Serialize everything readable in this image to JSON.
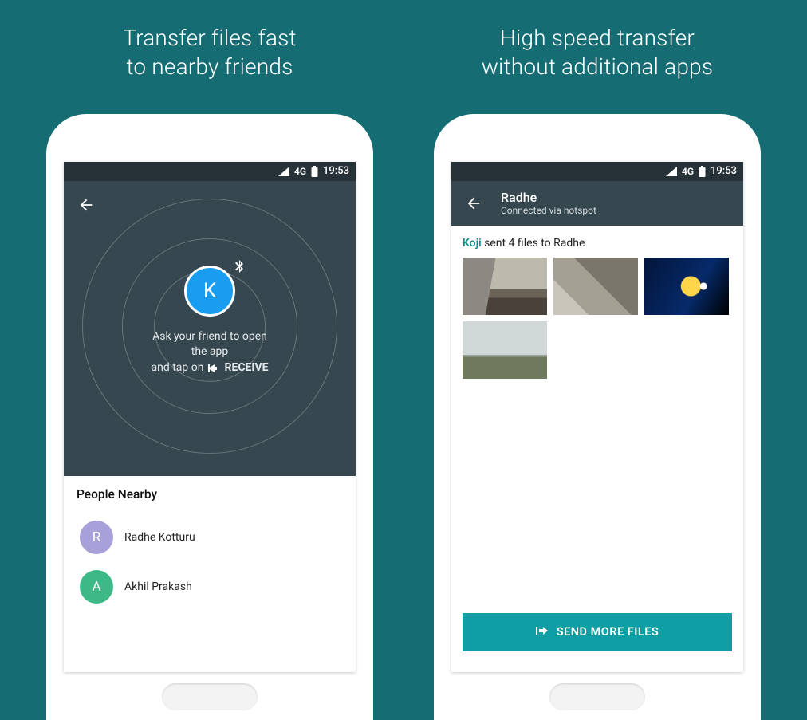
{
  "left": {
    "headline_l1": "Transfer files fast",
    "headline_l2": "to nearby friends",
    "status": {
      "network": "4G",
      "time": "19:53"
    },
    "avatar_letter": "K",
    "hint_l1": "Ask your friend to open the app",
    "hint_l2_prefix": "and tap on",
    "hint_l2_action": "RECEIVE",
    "list_title": "People Nearby",
    "people": [
      {
        "initial": "R",
        "name": "Radhe Kotturu",
        "color": "#a8a0d8"
      },
      {
        "initial": "A",
        "name": "Akhil Prakash",
        "color": "#3db887"
      }
    ]
  },
  "right": {
    "headline_l1": "High speed transfer",
    "headline_l2": "without additional apps",
    "status": {
      "network": "4G",
      "time": "19:53"
    },
    "appbar": {
      "title": "Radhe",
      "subtitle": "Connected via hotspot"
    },
    "sent": {
      "sender": "Koji",
      "rest": " sent 4 files to Radhe"
    },
    "button_label": "SEND MORE FILES"
  }
}
